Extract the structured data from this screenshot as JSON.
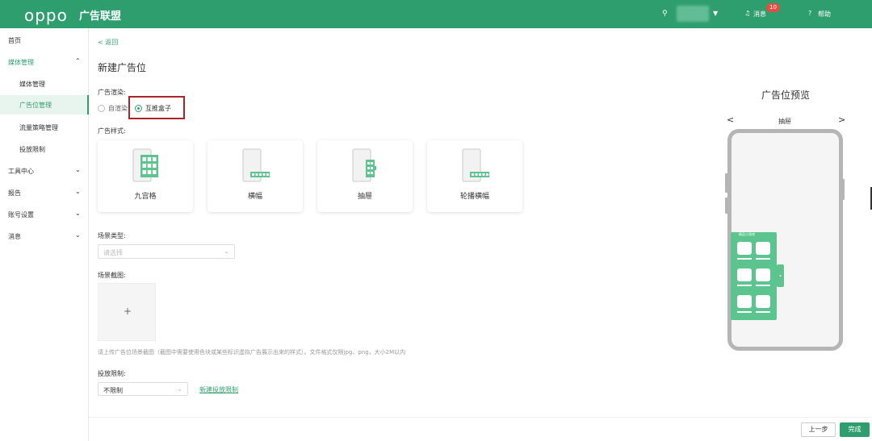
{
  "header": {
    "logo": "oppo",
    "brand": "广告联盟",
    "user_icon": "user-icon",
    "messages_label": "消息",
    "messages_count": "10",
    "help_label": "帮助"
  },
  "sidebar": {
    "items": [
      {
        "label": "首页",
        "expanded": null
      },
      {
        "label": "媒体管理",
        "expanded": true
      },
      {
        "label": "媒体管理",
        "expanded": null
      },
      {
        "label": "广告位管理",
        "expanded": null
      },
      {
        "label": "流量策略管理",
        "expanded": null
      },
      {
        "label": "投放限制",
        "expanded": null
      },
      {
        "label": "工具中心",
        "expanded": false
      },
      {
        "label": "报告",
        "expanded": false
      },
      {
        "label": "账号设置",
        "expanded": false
      },
      {
        "label": "消息",
        "expanded": false
      }
    ]
  },
  "main": {
    "back_label": "< 返回",
    "title": "新建广告位",
    "render_label": "广告渲染:",
    "render_options": [
      "自渲染",
      "互推盒子"
    ],
    "render_selected": "互推盒子",
    "style_label": "广告样式:",
    "styles": [
      "九宫格",
      "横幅",
      "抽屉",
      "轮播横幅"
    ],
    "scene_type_label": "场景类型:",
    "scene_type_placeholder": "请选择",
    "screenshot_label": "场景截图:",
    "upload_plus": "+",
    "hint": "请上传广告位场景截图（截图中需要使用色块或某些标识虚拟广告展示出来的样式）。文件格式仅限jpg、png，大小2M以内",
    "limit_label": "投放限制:",
    "limit_value": "不限制",
    "new_limit_link": "新建投放限制"
  },
  "preview": {
    "title": "广告位预览",
    "prev": "<",
    "next": ">",
    "type": "抽屉",
    "drawer_header": "精品小游戏"
  },
  "footer": {
    "prev_label": "上一步",
    "done_label": "完成"
  },
  "colors": {
    "brand": "#2f9e6e",
    "highlight": "#b0222a",
    "badge": "#e54d42",
    "illustration": "#5cc58f"
  }
}
